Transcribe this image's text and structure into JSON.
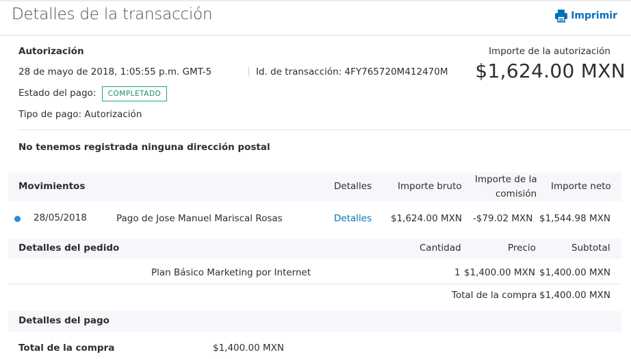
{
  "header": {
    "title": "Detalles de la transacción",
    "print_label": "Imprimir",
    "print_icon": "printer-icon"
  },
  "authorization": {
    "section_title": "Autorización",
    "datetime": "28 de mayo de 2018, 1:05:55 p.m. GMT-5",
    "transaction_id": "Id. de transacción: 4FY765720M412470M",
    "payment_status_label": "Estado del pago:",
    "payment_status": "COMPLETADO",
    "payment_type": "Tipo de pago: Autorización",
    "amount_label": "Importe de la autorización",
    "amount": "$1,624.00 MXN"
  },
  "address": {
    "message": "No tenemos registrada ninguna dirección postal"
  },
  "movements": {
    "headers": {
      "title": "Movimientos",
      "details": "Detalles",
      "gross": "Importe bruto",
      "fee_line1": "Importe de la",
      "fee_line2": "comisión",
      "net": "Importe neto"
    },
    "rows": [
      {
        "date": "28/05/2018",
        "description": "Pago de Jose Manuel Mariscal Rosas",
        "details_link": "Detalles",
        "gross": "$1,624.00 MXN",
        "fee": "-$79.02 MXN",
        "net": "$1,544.98 MXN"
      }
    ]
  },
  "order": {
    "headers": {
      "title": "Detalles del pedido",
      "quantity": "Cantidad",
      "price": "Precio",
      "subtotal": "Subtotal"
    },
    "items": [
      {
        "name": "Plan Básico Marketing por Internet",
        "quantity": "1",
        "price": "$1,400.00 MXN",
        "subtotal": "$1,400.00 MXN"
      }
    ],
    "total_label": "Total de la compra",
    "total": "$1,400.00 MXN"
  },
  "payment": {
    "title": "Detalles del pago",
    "total_label": "Total de la compra",
    "total": "$1,400.00 MXN"
  },
  "colors": {
    "link": "#0070ba",
    "status_border": "#1ea87a",
    "band": "#f5f7fa",
    "dot": "#2b8ad6"
  }
}
